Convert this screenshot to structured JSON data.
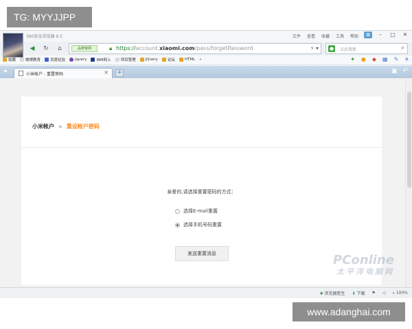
{
  "overlay": {
    "tag_label": "TG: MYYJJPP",
    "site_label": "www.adanghai.com"
  },
  "browser": {
    "app_title": "360安全浏览器 6.5",
    "menu": [
      "文件",
      "查看",
      "收藏",
      "工具",
      "帮助"
    ],
    "window_controls": [
      "skin",
      "minimize",
      "maximize",
      "close"
    ],
    "address": {
      "safety_badge": "品牌官网",
      "url_scheme": "https://",
      "url_prefix": "account.",
      "url_host": "xiaomi.com",
      "url_path": "/pass/forgetPassword"
    },
    "search": {
      "placeholder": "点此搜索"
    },
    "bookmarks": [
      "收藏",
      "微博教育",
      "百度经验",
      "jquery",
      "IBM网上",
      "项目管理",
      "jQuery",
      "论坛",
      "HTML",
      "»"
    ],
    "tab": {
      "title": "小米帐户 - 重置密码"
    },
    "status": {
      "doctor": "浏览器医生",
      "download": "下载",
      "zoom": "100%"
    },
    "colors": {
      "accent_orange": "#ff8a1c",
      "url_green": "#1d7a2b",
      "tabbar_blue": "#b3c9df"
    }
  },
  "page": {
    "breadcrumb": {
      "root": "小米帐户",
      "separator": ">",
      "current": "重设帐户密码"
    },
    "prompt": "亲爱的,请选择重置密码的方式：",
    "options": [
      {
        "label": "选择E-mail重置",
        "checked": false
      },
      {
        "label": "选择手机号码重置",
        "checked": true
      }
    ],
    "send_button": "发送重置消息"
  },
  "watermark": {
    "main": "PConline",
    "sub": "太平洋电脑网"
  }
}
